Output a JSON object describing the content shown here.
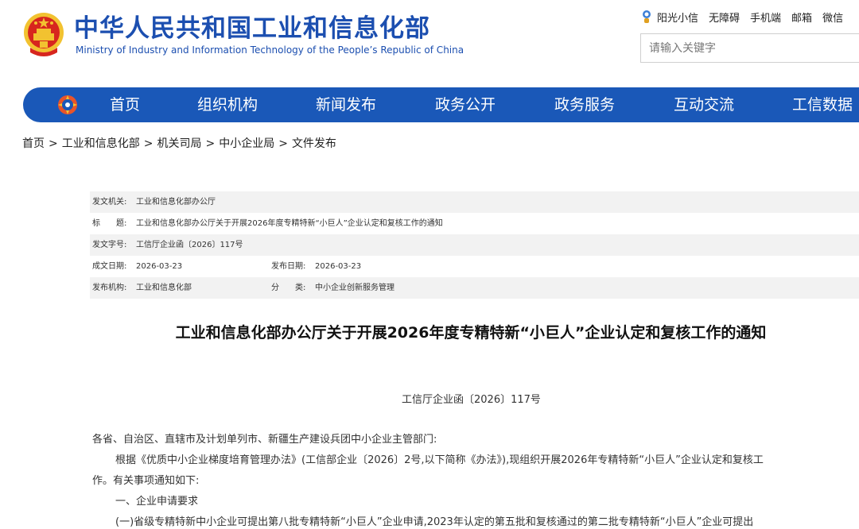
{
  "header": {
    "title_cn": "中华人民共和国工业和信息化部",
    "title_en": "Ministry of Industry and Information Technology of the People’s Republic of China",
    "top_links": [
      "阳光小信",
      "无障碍",
      "手机端",
      "邮箱",
      "微信"
    ],
    "search_placeholder": "请输入关键字"
  },
  "nav": {
    "items": [
      "首页",
      "组织机构",
      "新闻发布",
      "政务公开",
      "政务服务",
      "互动交流",
      "工信数据"
    ]
  },
  "breadcrumb": [
    "首页",
    "工业和信息化部",
    "机关司局",
    "中小企业局",
    "文件发布"
  ],
  "breadcrumb_sep": ">",
  "meta": {
    "issuer_label": "发文机关:",
    "issuer": "工业和信息化部办公厅",
    "title_label": "标　　题:",
    "title": "工业和信息化部办公厅关于开展2026年度专精特新“小巨人”企业认定和复核工作的通知",
    "doc_no_label": "发文字号:",
    "doc_no": "工信厅企业函〔2026〕117号",
    "written_date_label": "成文日期:",
    "written_date": "2026-03-23",
    "publish_date_label": "发布日期:",
    "publish_date": "2026-03-23",
    "publisher_label": "发布机构:",
    "publisher": "工业和信息化部",
    "category_label": "分　　类:",
    "category": "中小企业创新服务管理"
  },
  "article": {
    "title": "工业和信息化部办公厅关于开展2026年度专精特新“小巨人”企业认定和复核工作的通知",
    "doc_number": "工信厅企业函〔2026〕117号",
    "paragraphs": [
      "各省、自治区、直辖市及计划单列市、新疆生产建设兵团中小企业主管部门:",
      "根据《优质中小企业梯度培育管理办法》(工信部企业〔2026〕2号,以下简称《办法》),现组织开展2026年专精特新“小巨人”企业认定和复核工",
      "作。有关事项通知如下:",
      "一、企业申请要求",
      "(一)省级专精特新中小企业可提出第八批专精特新“小巨人”企业申请,2023年认定的第五批和复核通过的第二批专精特新“小巨人”企业可提出"
    ]
  },
  "colors": {
    "brand_blue": "#1a58b8",
    "title_blue": "#1c4fb0",
    "emblem_red": "#d7261e",
    "emblem_gold": "#f2c230",
    "meta_row_alt": "#f2f2f2"
  }
}
